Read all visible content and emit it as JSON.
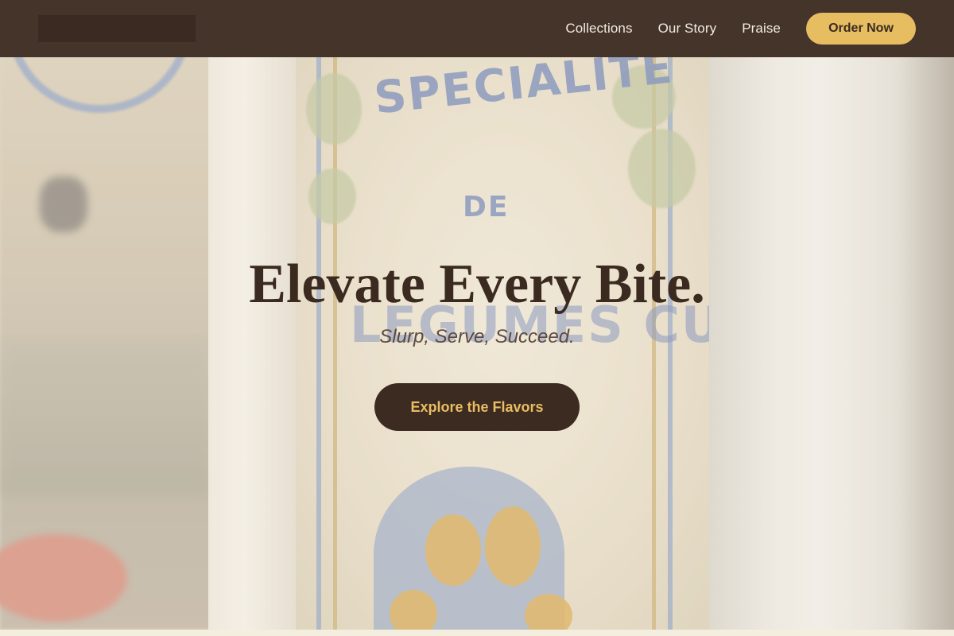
{
  "nav": {
    "links": [
      "Collections",
      "Our Story",
      "Praise"
    ],
    "order_label": "Order Now"
  },
  "hero": {
    "title": "Elevate Every Bite.",
    "subtitle": "Slurp, Serve, Succeed.",
    "cta_label": "Explore the Flavors"
  },
  "colors": {
    "nav_bg": "#45342a",
    "accent_gold": "#e7bd62",
    "dark_brown": "#3c2b21"
  }
}
